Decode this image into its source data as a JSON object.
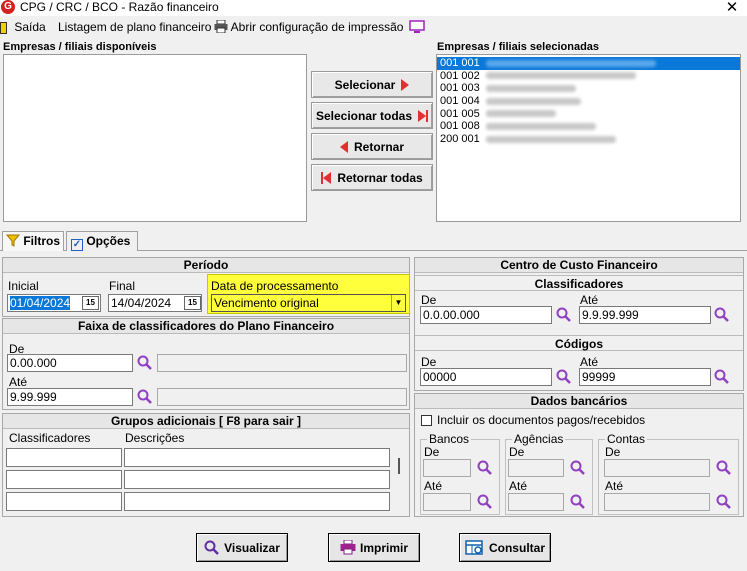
{
  "window": {
    "title": "CPG / CRC / BCO - Razão financeiro",
    "close_glyph": "✕"
  },
  "toolbar": {
    "exit_label": "Saída",
    "listing_label": "Listagem de plano financeiro",
    "print_config_label": "Abrir configuração de impressão"
  },
  "available": {
    "label": "Empresas / filiais disponíveis"
  },
  "selected": {
    "label": "Empresas / filiais selecionadas",
    "items": [
      "001 001",
      "001 002",
      "001 003",
      "001 004",
      "001 005",
      "001 008",
      "200 001"
    ]
  },
  "move_buttons": {
    "select": "Selecionar",
    "select_all": "Selecionar todas",
    "back": "Retornar",
    "back_all": "Retornar todas"
  },
  "tabs": {
    "filters": "Filtros",
    "options": "Opções"
  },
  "periodo": {
    "title": "Período",
    "initial_label": "Inicial",
    "initial_value": "01/04/2024",
    "final_label": "Final",
    "final_value": "14/04/2024",
    "calendar_glyph": "15",
    "processing_label": "Data de processamento",
    "processing_value": "Vencimento original"
  },
  "faixa": {
    "title": "Faixa de classificadores do Plano Financeiro",
    "de_label": "De",
    "de_value": "0.00.000",
    "ate_label": "Até",
    "ate_value": "9.99.999"
  },
  "grupos": {
    "title": "Grupos adicionais [ F8 para sair ]",
    "col_class": "Classificadores",
    "col_desc": "Descrições"
  },
  "centro": {
    "title": "Centro de Custo Financeiro",
    "class_title": "Classificadores",
    "class_de_label": "De",
    "class_de_value": "0.0.00.000",
    "class_ate_label": "Até",
    "class_ate_value": "9.9.99.999",
    "cod_title": "Códigos",
    "cod_de_label": "De",
    "cod_de_value": "00000",
    "cod_ate_label": "Até",
    "cod_ate_value": "99999"
  },
  "bancarios": {
    "title": "Dados bancários",
    "include_label": "Incluir os documentos pagos/recebidos",
    "bancos": "Bancos",
    "agencias": "Agências",
    "contas": "Contas",
    "de": "De",
    "ate": "Até"
  },
  "actions": {
    "view": "Visualizar",
    "print": "Imprimir",
    "query": "Consultar"
  },
  "colors": {
    "highlight": "#ffff3c",
    "selection": "#0a78d8",
    "accent_red": "#e03030"
  }
}
